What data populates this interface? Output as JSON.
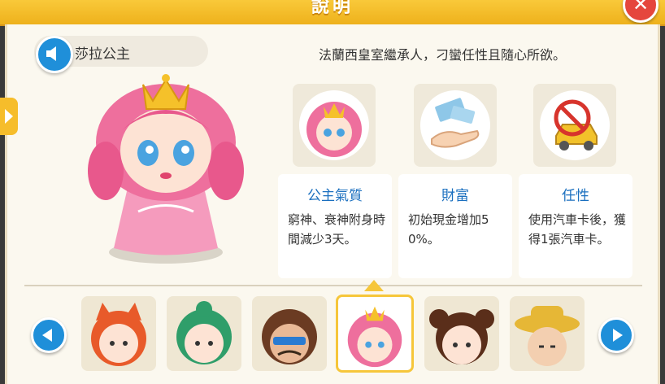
{
  "header": {
    "title": "說明",
    "close_glyph": "✕"
  },
  "character": {
    "name": "莎拉公主",
    "description": "法蘭西皇室繼承人，刁蠻任性且隨心所欲。"
  },
  "traits": [
    {
      "icon": "princess-portrait-icon",
      "title": "公主氣質",
      "text": "窮神、衰神附身時間減少3天。"
    },
    {
      "icon": "money-hand-icon",
      "title": "財富",
      "text": "初始現金增加50%。"
    },
    {
      "icon": "no-private-car-icon",
      "title": "任性",
      "text": "使用汽車卡後，獲得1張汽車卡。"
    }
  ],
  "roster": [
    {
      "icon": "fox-girl-avatar-icon",
      "selected": false
    },
    {
      "icon": "green-hair-boy-avatar-icon",
      "selected": false
    },
    {
      "icon": "sunglasses-man-avatar-icon",
      "selected": false
    },
    {
      "icon": "princess-avatar-icon",
      "selected": true
    },
    {
      "icon": "bun-girl-avatar-icon",
      "selected": false
    },
    {
      "icon": "straw-hat-elder-avatar-icon",
      "selected": false
    }
  ],
  "colors": {
    "header": "#f3bd2a",
    "accent_blue": "#1f8fd9",
    "title_blue": "#1a6fbf",
    "panel": "#fbf8ef"
  }
}
